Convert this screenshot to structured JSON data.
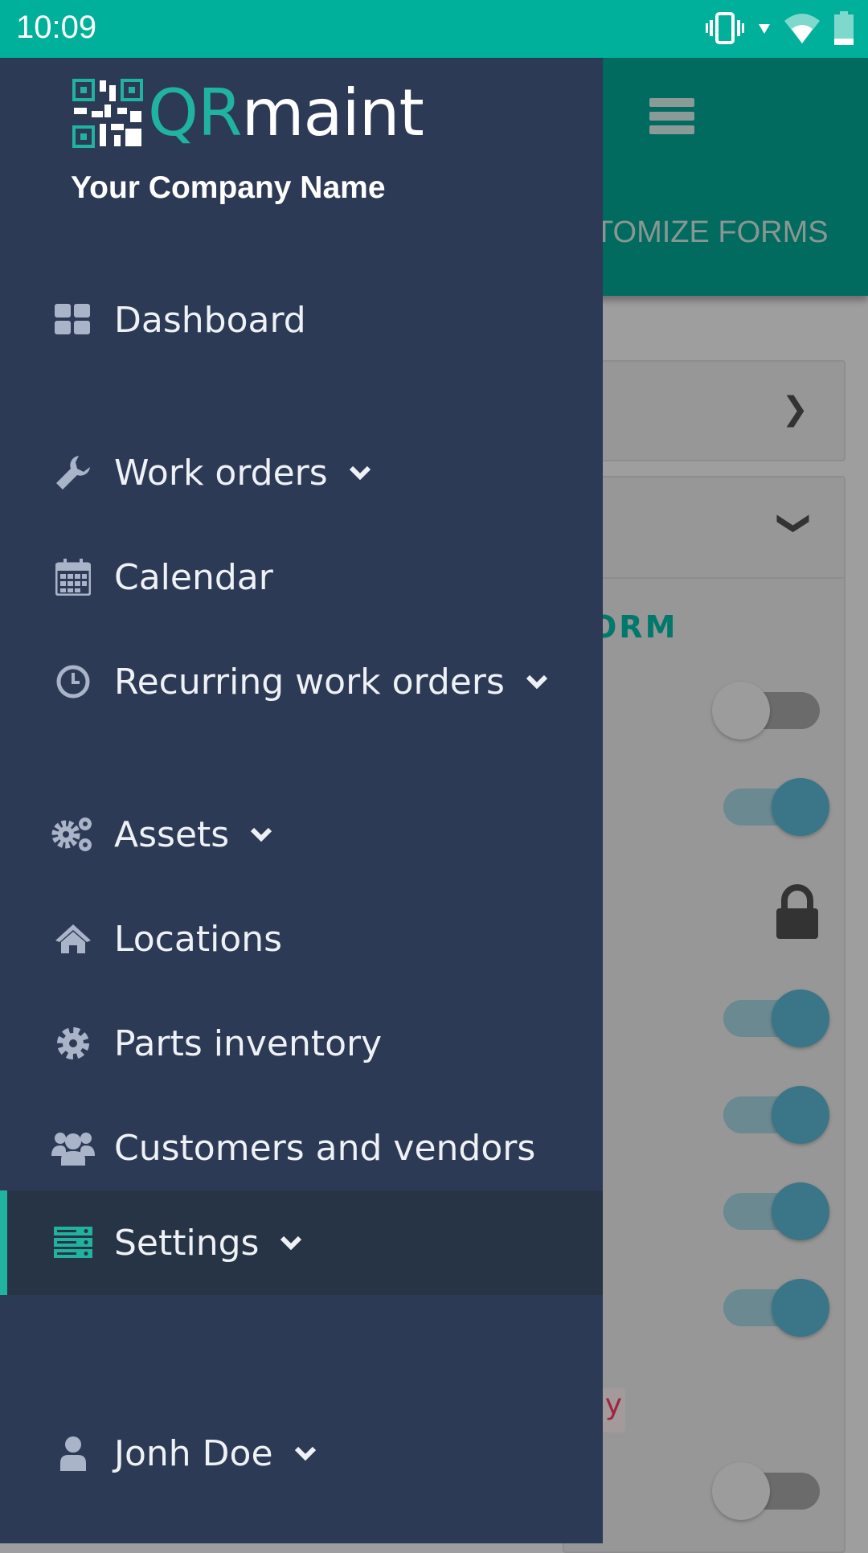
{
  "status_bar": {
    "time": "10:09",
    "icons": [
      "vibrate-icon",
      "signal-icon",
      "wifi-icon",
      "battery-icon"
    ]
  },
  "background_page": {
    "tab_label": "TOMIZE FORMS",
    "section_label": "ORM",
    "badge_text": "y",
    "toggles": [
      false,
      true,
      "locked",
      true,
      true,
      true,
      true,
      false
    ],
    "accent": "#006b5e"
  },
  "drawer": {
    "logo": {
      "part1": "QR",
      "part2": "maint"
    },
    "company": "Your Company Name",
    "items": [
      {
        "label": "Dashboard",
        "icon": "dashboard-icon",
        "expandable": false
      },
      {
        "label": "Work orders",
        "icon": "wrench-icon",
        "expandable": true
      },
      {
        "label": "Calendar",
        "icon": "calendar-icon",
        "expandable": false
      },
      {
        "label": "Recurring work orders",
        "icon": "clock-icon",
        "expandable": true
      },
      {
        "label": "Assets",
        "icon": "gears-icon",
        "expandable": true
      },
      {
        "label": "Locations",
        "icon": "home-icon",
        "expandable": false
      },
      {
        "label": "Parts inventory",
        "icon": "gear-icon",
        "expandable": false
      },
      {
        "label": "Customers and vendors",
        "icon": "users-icon",
        "expandable": false
      },
      {
        "label": "Settings",
        "icon": "server-icon",
        "expandable": true,
        "active": true
      },
      {
        "label": "Jonh Doe",
        "icon": "user-icon",
        "expandable": true
      }
    ],
    "colors": {
      "background": "#2d3a55",
      "active": "#273445",
      "accent": "#1fb3a0"
    }
  }
}
